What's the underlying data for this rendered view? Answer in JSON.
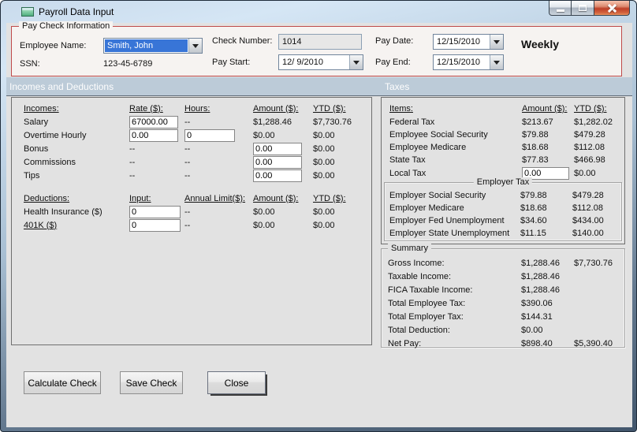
{
  "window": {
    "title": "Payroll Data Input"
  },
  "paycheck": {
    "title": "Pay Check Information",
    "employee_label": "Employee Name:",
    "employee_value": "Smith, John",
    "ssn_label": "SSN:",
    "ssn_value": "123-45-6789",
    "check_number_label": "Check Number:",
    "check_number_value": "1014",
    "pay_start_label": "Pay Start:",
    "pay_start_value": "12/ 9/2010",
    "pay_date_label": "Pay Date:",
    "pay_date_value": "12/15/2010",
    "pay_end_label": "Pay End:",
    "pay_end_value": "12/15/2010",
    "frequency": "Weekly"
  },
  "sections": {
    "left": "Incomes and Deductions",
    "right": "Taxes"
  },
  "incomes": {
    "h": {
      "c0": "Incomes:",
      "c1": "Rate ($):",
      "c2": "Hours:",
      "c3": "Amount ($):",
      "c4": "YTD ($):"
    },
    "rows": [
      {
        "label": "Salary",
        "rate": "67000.00",
        "hours": "--",
        "amount": "$1,288.46",
        "ytd": "$7,730.76"
      },
      {
        "label": "Overtime Hourly",
        "rate": "0.00",
        "hours": "0",
        "amount": "$0.00",
        "ytd": "$0.00"
      },
      {
        "label": "Bonus",
        "rate": "--",
        "hours": "--",
        "amount": "0.00",
        "ytd": "$0.00"
      },
      {
        "label": "Commissions",
        "rate": "--",
        "hours": "--",
        "amount": "0.00",
        "ytd": "$0.00"
      },
      {
        "label": "Tips",
        "rate": "--",
        "hours": "--",
        "amount": "0.00",
        "ytd": "$0.00"
      }
    ]
  },
  "deductions": {
    "h": {
      "c0": "Deductions:",
      "c1": "Input:",
      "c2": "Annual Limit($):",
      "c3": "Amount ($):",
      "c4": "YTD ($):"
    },
    "rows": [
      {
        "label": "Health Insurance ($)",
        "input": "0",
        "limit": "--",
        "amount": "$0.00",
        "ytd": "$0.00"
      },
      {
        "label": "401K ($)",
        "input": "0",
        "limit": "--",
        "amount": "$0.00",
        "ytd": "$0.00"
      }
    ]
  },
  "taxes": {
    "h": {
      "c0": "Items:",
      "c1": "Amount ($):",
      "c2": "YTD ($):"
    },
    "rows": [
      {
        "label": "Federal Tax",
        "amount": "$213.67",
        "ytd": "$1,282.02"
      },
      {
        "label": "Employee Social Security",
        "amount": "$79.88",
        "ytd": "$479.28"
      },
      {
        "label": "Employee Medicare",
        "amount": "$18.68",
        "ytd": "$112.08"
      },
      {
        "label": "State Tax",
        "amount": "$77.83",
        "ytd": "$466.98"
      },
      {
        "label": "Local Tax",
        "amount": "0.00",
        "ytd": "$0.00"
      }
    ]
  },
  "employer_tax": {
    "title": "Employer Tax",
    "rows": [
      {
        "label": "Employer Social Security",
        "amount": "$79.88",
        "ytd": "$479.28"
      },
      {
        "label": "Employer Medicare",
        "amount": "$18.68",
        "ytd": "$112.08"
      },
      {
        "label": "Employer Fed Unemployment",
        "amount": "$34.60",
        "ytd": "$434.00"
      },
      {
        "label": "Employer State Unemployment",
        "amount": "$11.15",
        "ytd": "$140.00"
      }
    ]
  },
  "summary": {
    "title": "Summary",
    "rows": [
      {
        "label": "Gross Income:",
        "amount": "$1,288.46",
        "ytd": "$7,730.76"
      },
      {
        "label": "Taxable Income:",
        "amount": "$1,288.46",
        "ytd": ""
      },
      {
        "label": "FICA Taxable Income:",
        "amount": "$1,288.46",
        "ytd": ""
      },
      {
        "label": "Total Employee Tax:",
        "amount": "$390.06",
        "ytd": ""
      },
      {
        "label": "Total Employer Tax:",
        "amount": "$144.31",
        "ytd": ""
      },
      {
        "label": "Total Deduction:",
        "amount": "$0.00",
        "ytd": ""
      },
      {
        "label": "Net Pay:",
        "amount": "$898.40",
        "ytd": "$5,390.40"
      }
    ]
  },
  "buttons": {
    "calculate": "Calculate Check",
    "save": "Save Check",
    "close": "Close"
  },
  "colors": {
    "group_border": "#bf4a4a",
    "band_bg": "#bccbd8",
    "selection": "#3875d7"
  }
}
